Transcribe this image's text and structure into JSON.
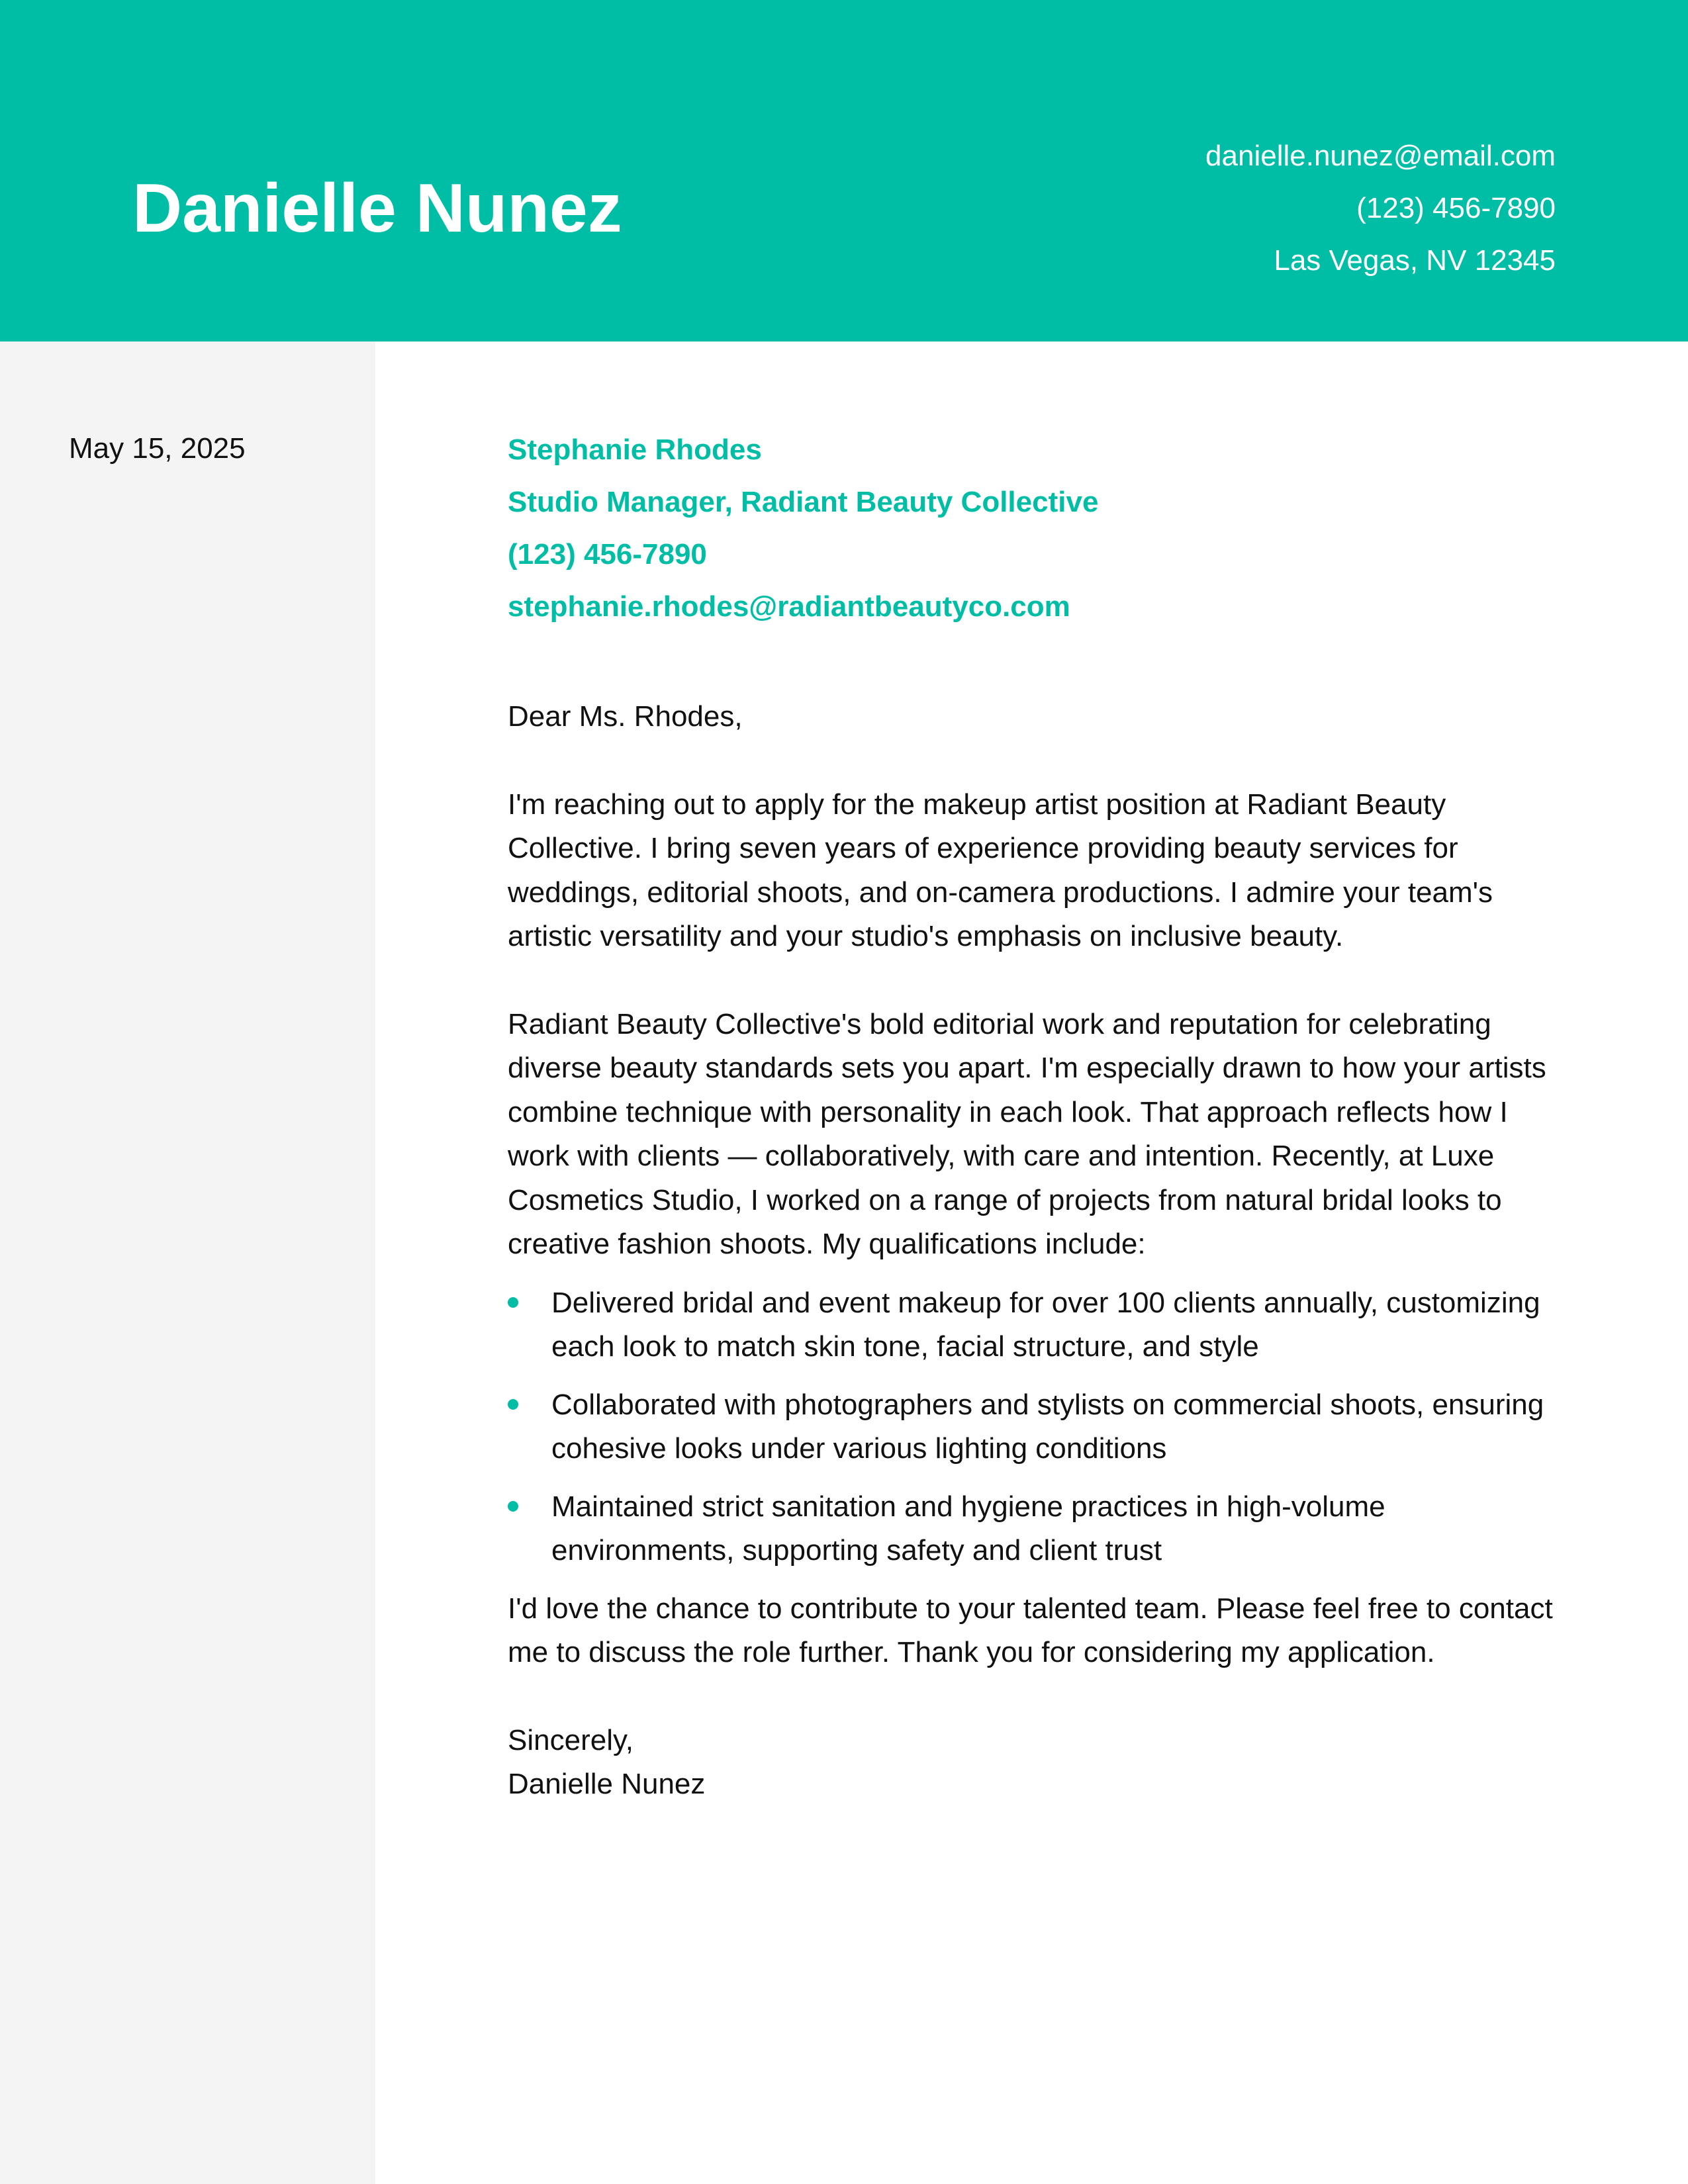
{
  "header": {
    "name": "Danielle Nunez",
    "email": "danielle.nunez@email.com",
    "phone": "(123) 456-7890",
    "location": "Las Vegas, NV 12345",
    "accent_color": "#00bda5"
  },
  "sidebar": {
    "date": "May 15, 2025",
    "background_color": "#f4f4f4"
  },
  "recipient": {
    "name": "Stephanie Rhodes",
    "title": "Studio Manager, Radiant Beauty Collective",
    "phone": "(123) 456-7890",
    "email": "stephanie.rhodes@radiantbeautyco.com"
  },
  "letter": {
    "salutation": "Dear Ms. Rhodes,",
    "paragraph1": "I'm reaching out to apply for the makeup artist position at Radiant Beauty Collective. I bring seven years of experience providing beauty services for weddings, editorial shoots, and on-camera productions. I admire your team's artistic versatility and your studio's emphasis on inclusive beauty.",
    "paragraph2": "Radiant Beauty Collective's bold editorial work and reputation for celebrating diverse beauty standards sets you apart. I'm especially drawn to how your artists combine technique with personality in each look. That approach reflects how I work with clients — collaboratively, with care and intention. Recently, at Luxe Cosmetics Studio, I worked on a range of projects from natural bridal looks to creative fashion shoots. My qualifications include:",
    "bullets": [
      "Delivered bridal and event makeup for over 100 clients annually, customizing each look to match skin tone, facial structure, and style",
      "Collaborated with photographers and stylists on commercial shoots, ensuring cohesive looks under various lighting conditions",
      "Maintained strict sanitation and hygiene practices in high-volume environments, supporting safety and client trust"
    ],
    "closing_paragraph": "I'd love the chance to contribute to your talented team. Please feel free to contact me to discuss the role further. Thank you for considering my application.",
    "signoff": "Sincerely,",
    "signature": "Danielle Nunez"
  }
}
